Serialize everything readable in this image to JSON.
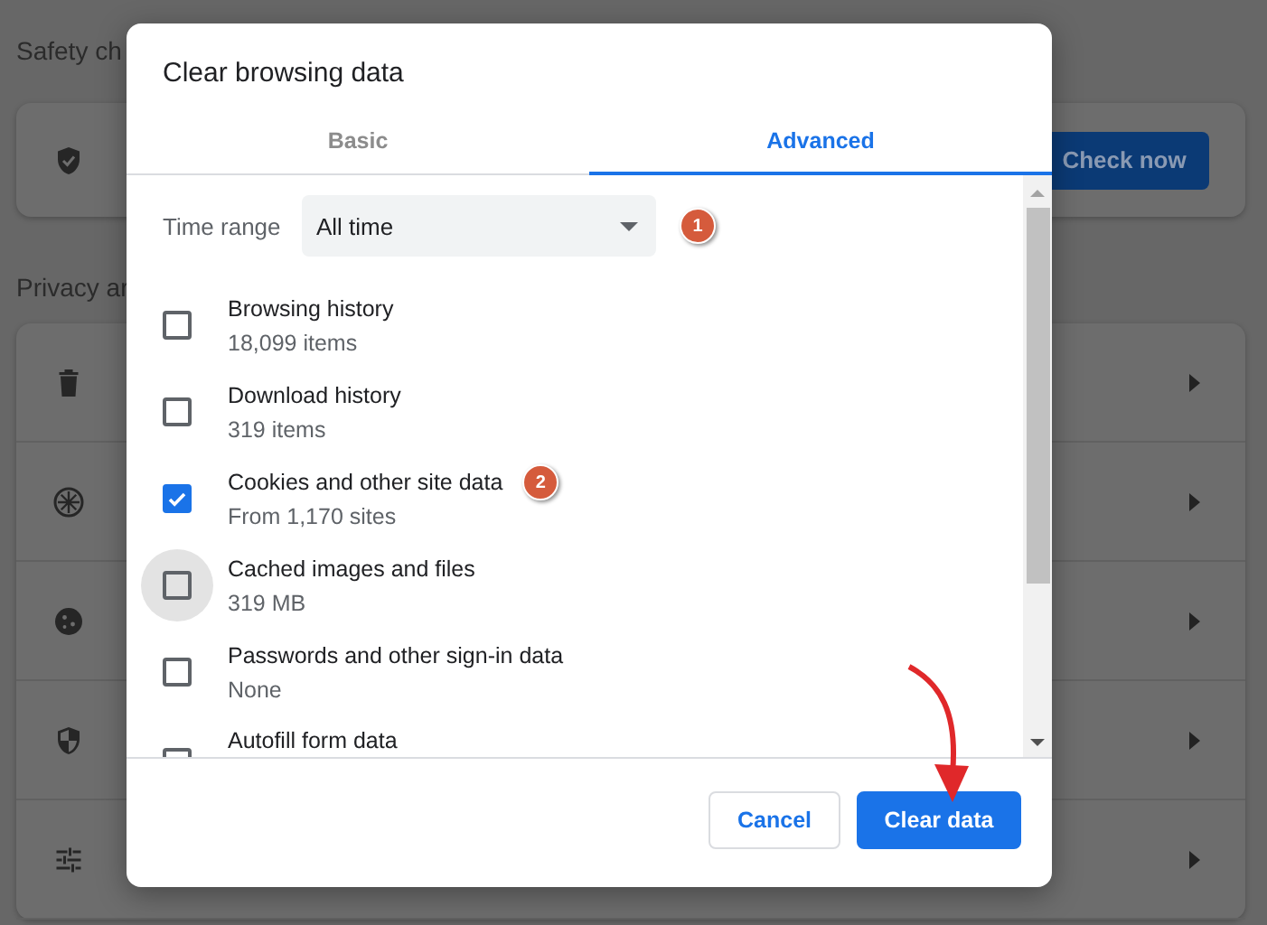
{
  "settings": {
    "safety_heading": "Safety ch",
    "safety_card": {
      "button": "Check now"
    },
    "privacy_heading": "Privacy ar"
  },
  "dialog": {
    "title": "Clear browsing data",
    "tabs": [
      {
        "label": "Basic",
        "selected": false
      },
      {
        "label": "Advanced",
        "selected": true
      }
    ],
    "time_range": {
      "label": "Time range",
      "value": "All time",
      "badge": "1"
    },
    "items": [
      {
        "title": "Browsing history",
        "subtitle": "18,099 items",
        "checked": false,
        "focused": false
      },
      {
        "title": "Download history",
        "subtitle": "319 items",
        "checked": false,
        "focused": false
      },
      {
        "title": "Cookies and other site data",
        "subtitle": "From 1,170 sites",
        "checked": true,
        "focused": false,
        "badge": "2"
      },
      {
        "title": "Cached images and files",
        "subtitle": "319 MB",
        "checked": false,
        "focused": true
      },
      {
        "title": "Passwords and other sign-in data",
        "subtitle": "None",
        "checked": false,
        "focused": false
      },
      {
        "title": "Autofill form data",
        "checked": false,
        "focused": false
      }
    ],
    "buttons": [
      {
        "label": "Cancel",
        "kind": "secondary"
      },
      {
        "label": "Clear data",
        "kind": "primary"
      }
    ]
  }
}
